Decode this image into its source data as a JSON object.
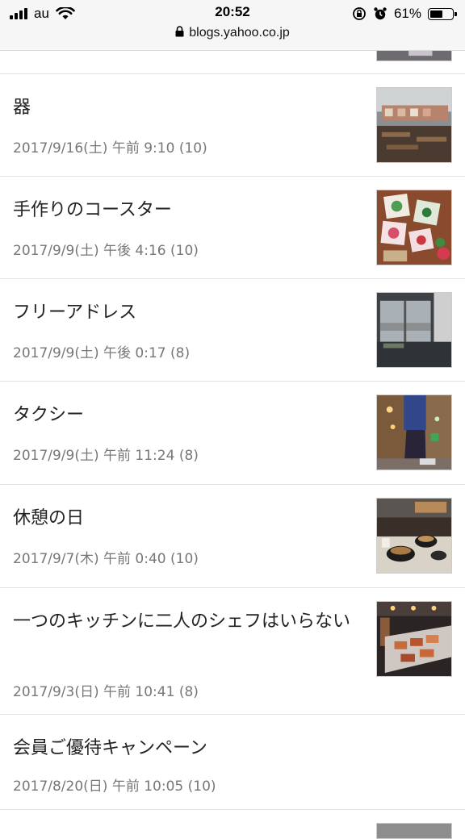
{
  "status_bar": {
    "carrier": "au",
    "time": "20:52",
    "battery_percent": "61%",
    "battery_level": 0.61,
    "url": "blogs.yahoo.co.jp"
  },
  "posts": [
    {
      "title": "器",
      "meta": "2017/9/16(土) 午前 9:10 (10)"
    },
    {
      "title": "手作りのコースター",
      "meta": "2017/9/9(土) 午後 4:16 (10)"
    },
    {
      "title": "フリーアドレス",
      "meta": "2017/9/9(土) 午後 0:17 (8)"
    },
    {
      "title": "タクシー",
      "meta": "2017/9/9(土) 午前 11:24 (8)"
    },
    {
      "title": "休憩の日",
      "meta": "2017/9/7(木) 午前 0:40 (10)"
    },
    {
      "title": "一つのキッチンに二人のシェフはいらない",
      "meta": "2017/9/3(日) 午前 10:41 (8)"
    },
    {
      "title": "会員ご優待キャンペーン",
      "meta": "2017/8/20(日) 午前 10:05 (10)"
    }
  ]
}
